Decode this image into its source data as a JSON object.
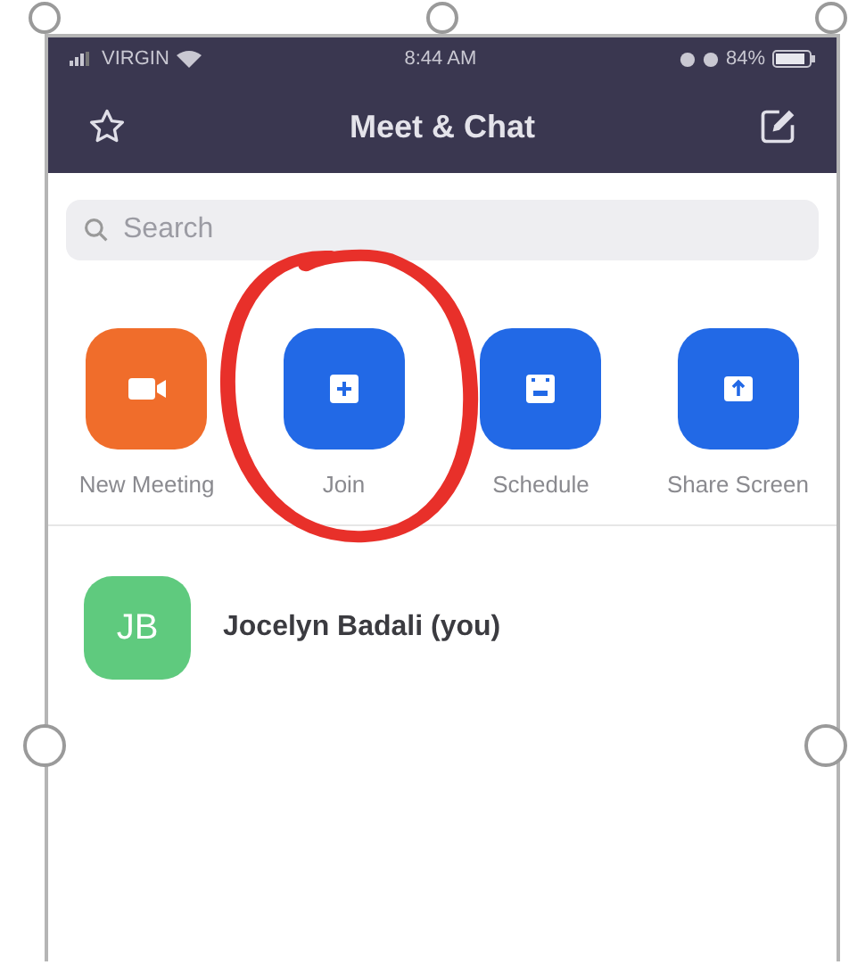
{
  "status_bar": {
    "carrier": "VIRGIN",
    "time": "8:44 AM",
    "battery": "84%"
  },
  "header": {
    "title": "Meet & Chat"
  },
  "search": {
    "placeholder": "Search"
  },
  "actions": [
    {
      "kind": "video",
      "label": "New Meeting",
      "color": "#f06d2b"
    },
    {
      "kind": "plus",
      "label": "Join",
      "color": "#2269e6"
    },
    {
      "kind": "calendar",
      "label": "Schedule",
      "color": "#2269e6"
    },
    {
      "kind": "share",
      "label": "Share Screen",
      "color": "#2269e6"
    }
  ],
  "contacts": [
    {
      "initials": "JB",
      "name": "Jocelyn Badali (you)",
      "color": "#5fca7e"
    }
  ]
}
